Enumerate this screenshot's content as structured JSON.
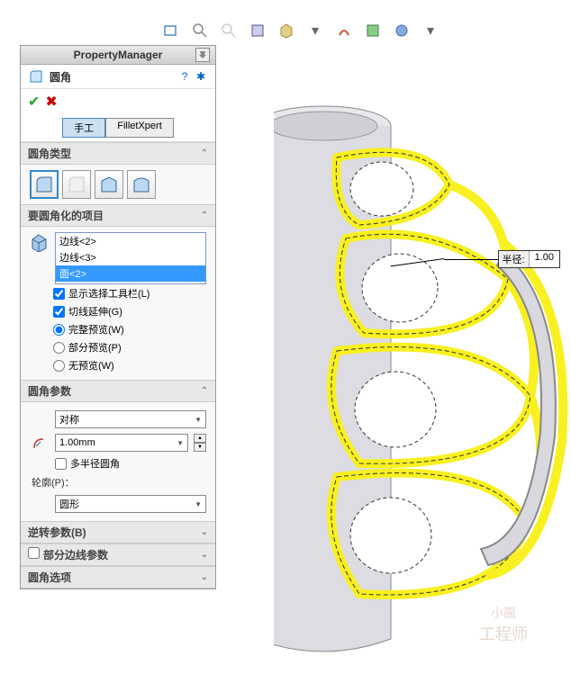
{
  "header": {
    "title": "PropertyManager"
  },
  "feature": {
    "name": "圆角"
  },
  "tabs": {
    "manual": "手工",
    "xpert": "FilletXpert"
  },
  "sections": {
    "type": "圆角类型",
    "items": "要圆角化的项目",
    "params": "圆角参数",
    "reverse": "逆转参数(B)",
    "partial": "部分边线参数",
    "options": "圆角选项"
  },
  "itemsList": {
    "items": [
      "边线<2>",
      "边线<3>",
      "面<2>"
    ],
    "selectedIndex": 2
  },
  "checks": {
    "showToolbar": "显示选择工具栏(L)",
    "tangent": "切线延伸(G)"
  },
  "previewOptions": {
    "full": "完整预览(W)",
    "partial": "部分预览(P)",
    "none": "无预览(W)"
  },
  "params": {
    "symLabel": "对称",
    "radiusValue": "1.00mm",
    "multiRadius": "多半径圆角",
    "profileLabel": "轮廓(P)：",
    "profileValue": "圆形"
  },
  "callout": {
    "label": "半径:",
    "value": "1.00"
  },
  "watermark": {
    "line1": "小團",
    "line2": "工程师"
  }
}
